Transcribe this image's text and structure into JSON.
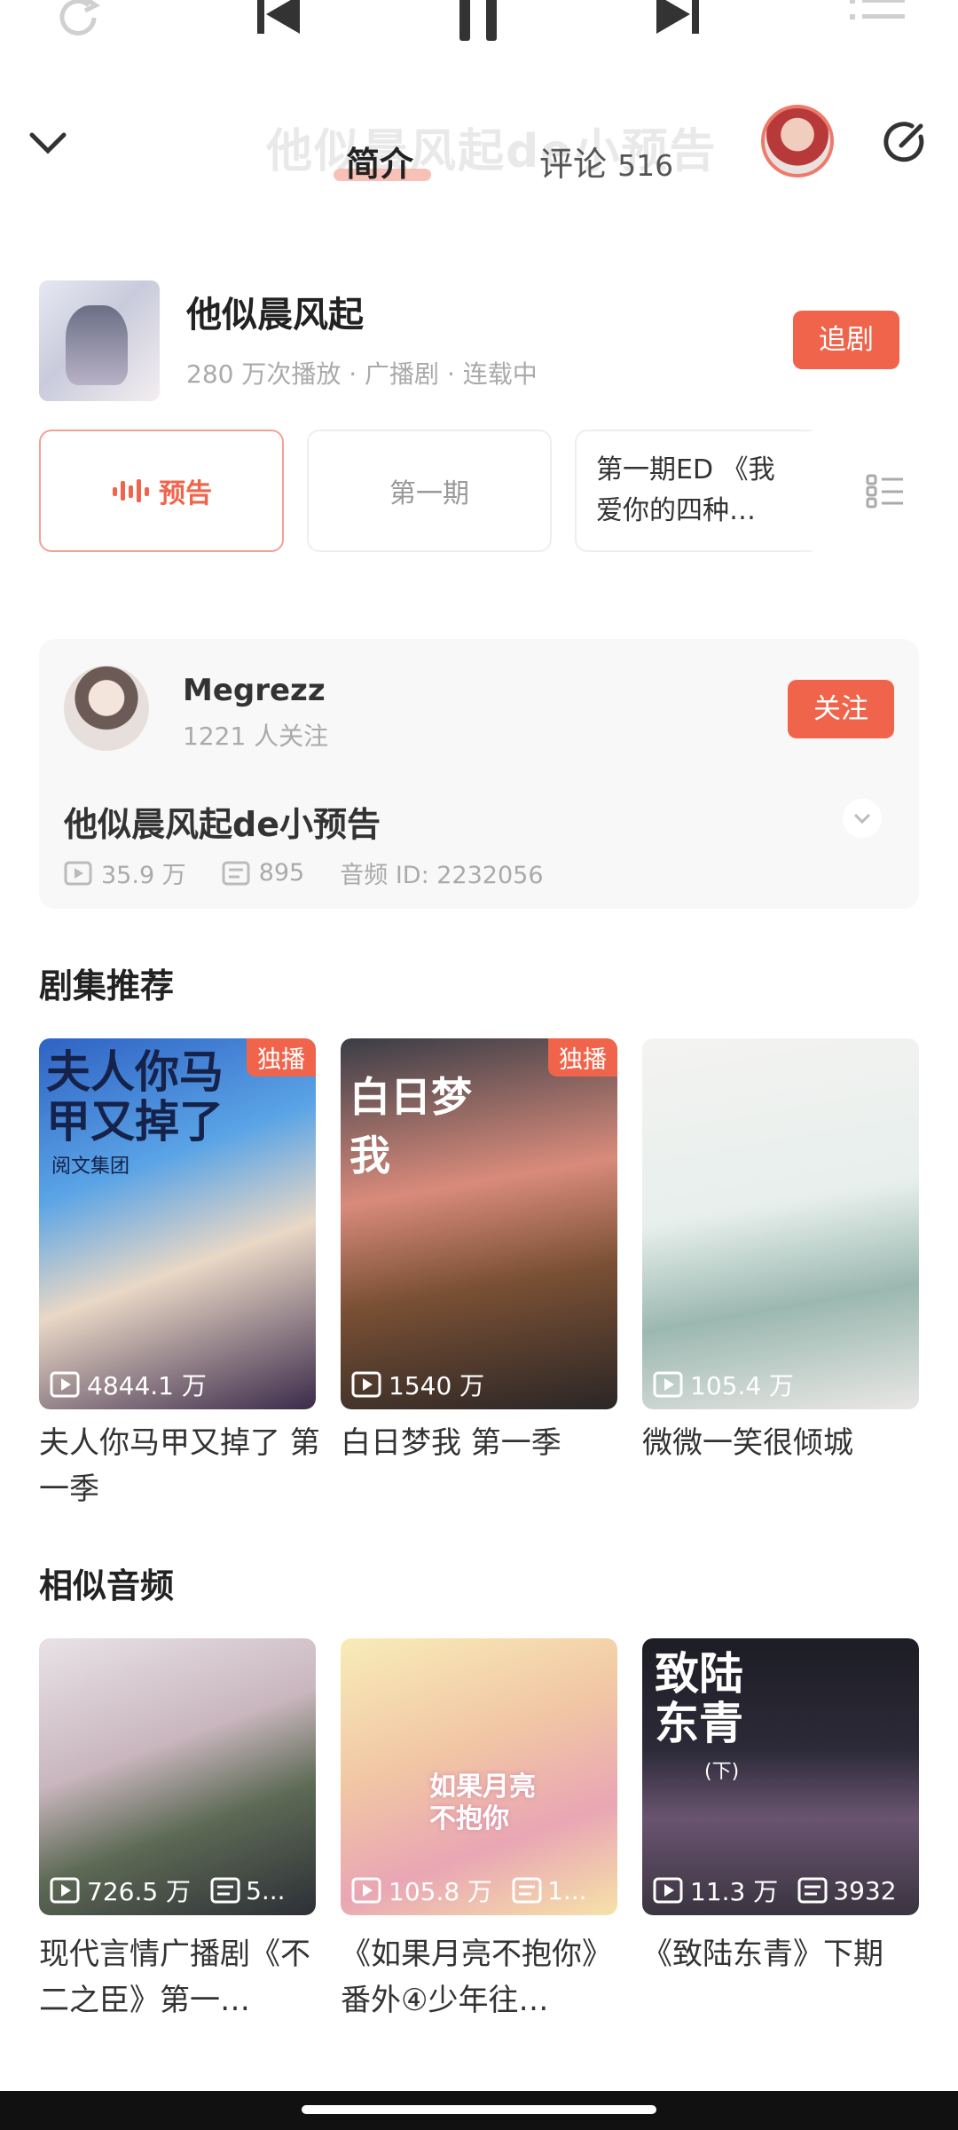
{
  "player": {
    "icons": [
      "repeat-icon",
      "previous-icon",
      "pause-icon",
      "next-icon",
      "playlist-icon"
    ]
  },
  "header": {
    "ghost_title": "他似晨风起de小预告",
    "tab_intro": "简介",
    "tab_comments": "评论",
    "comment_count": "516"
  },
  "drama": {
    "title": "他似晨风起",
    "meta": "280 万次播放 · 广播剧 · 连载中",
    "follow_label": "追剧"
  },
  "episodes": {
    "items": [
      "预告",
      "第一期",
      "第一期ED 《我爱你的四种…"
    ]
  },
  "uploader": {
    "name": "Megrezz",
    "fans": "1221 人关注",
    "follow_label": "关注"
  },
  "audio": {
    "title": "他似晨风起de小预告",
    "plays": "35.9 万",
    "danmaku": "895",
    "audio_id": "音频 ID: 2232056"
  },
  "recommend": {
    "title": "剧集推荐",
    "items": [
      {
        "badge": "独播",
        "plays": "4844.1 万",
        "name": "夫人你马甲又掉了 第一季",
        "cover_text": "夫人你马甲又掉了",
        "cover_sub": "阅文集团"
      },
      {
        "badge": "独播",
        "plays": "1540 万",
        "name": "白日梦我 第一季",
        "cover_text": "白日梦我"
      },
      {
        "badge": "",
        "plays": "105.4 万",
        "name": "微微一笑很倾城"
      }
    ]
  },
  "similar": {
    "title": "相似音频",
    "items": [
      {
        "plays": "726.5 万",
        "danmaku": "5...",
        "name": "现代言情广播剧《不二之臣》第一…"
      },
      {
        "plays": "105.8 万",
        "danmaku": "1...",
        "name": "《如果月亮不抱你》番外④少年往…",
        "cover_text": "如果月亮不抱你"
      },
      {
        "plays": "11.3 万",
        "danmaku": "3932",
        "name": "《致陆东青》下期",
        "cover_text": "致陆东青",
        "cover_sub": "(下)"
      }
    ]
  },
  "colors": {
    "accent": "#f0644b",
    "text": "#222222",
    "muted": "#aaaaaa"
  }
}
